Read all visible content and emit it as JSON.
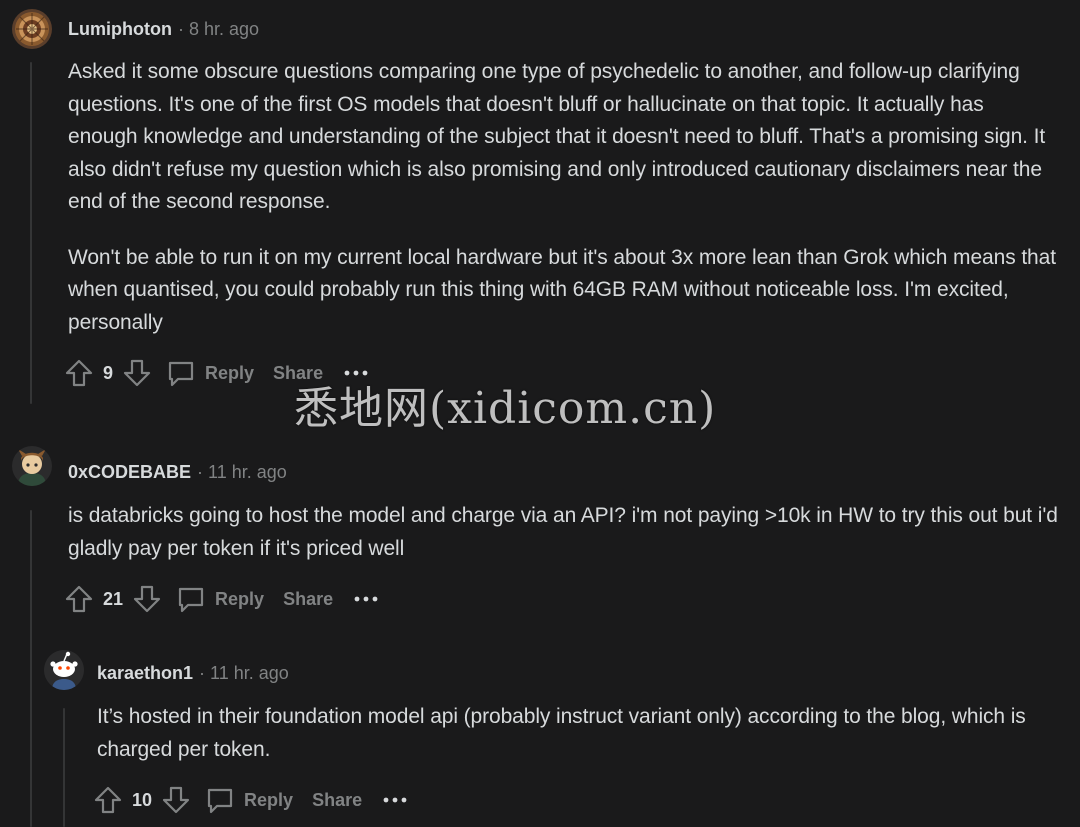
{
  "comments": [
    {
      "author": "Lumiphoton",
      "separator": "·",
      "time": "8 hr. ago",
      "paragraphs": [
        "Asked it some obscure questions comparing one type of psychedelic to another, and follow-up clarifying questions. It's one of the first OS models that doesn't bluff or hallucinate on that topic. It actually has enough knowledge and understanding of the subject that it doesn't need to bluff. That's a promising sign. It also didn't refuse my question which is also promising and only introduced cautionary disclaimers near the end of the second response.",
        "Won't be able to run it on my current local hardware but it's about 3x more lean than Grok which means that when quantised, you could probably run this thing with 64GB RAM without noticeable loss. I'm excited, personally"
      ],
      "votes": "9",
      "reply_label": "Reply",
      "share_label": "Share",
      "more_label": "···"
    },
    {
      "author": "0xCODEBABE",
      "separator": "·",
      "time": "11 hr. ago",
      "paragraphs": [
        "is databricks going to host the model and charge via an API? i'm not paying >10k in HW to try this out but i'd gladly pay per token if it's priced well"
      ],
      "votes": "21",
      "reply_label": "Reply",
      "share_label": "Share",
      "more_label": "···"
    },
    {
      "author": "karaethon1",
      "separator": "·",
      "time": "11 hr. ago",
      "paragraphs": [
        "It’s hosted in their foundation model api (probably instruct variant only) according to the blog, which is charged per token."
      ],
      "votes": "10",
      "reply_label": "Reply",
      "share_label": "Share",
      "more_label": "···"
    }
  ],
  "watermark": "悉地网(xidicom.cn)",
  "colors": {
    "background": "#1a1a1b",
    "text": "#d7dadc",
    "muted": "#818384",
    "thread_line": "#343536"
  }
}
